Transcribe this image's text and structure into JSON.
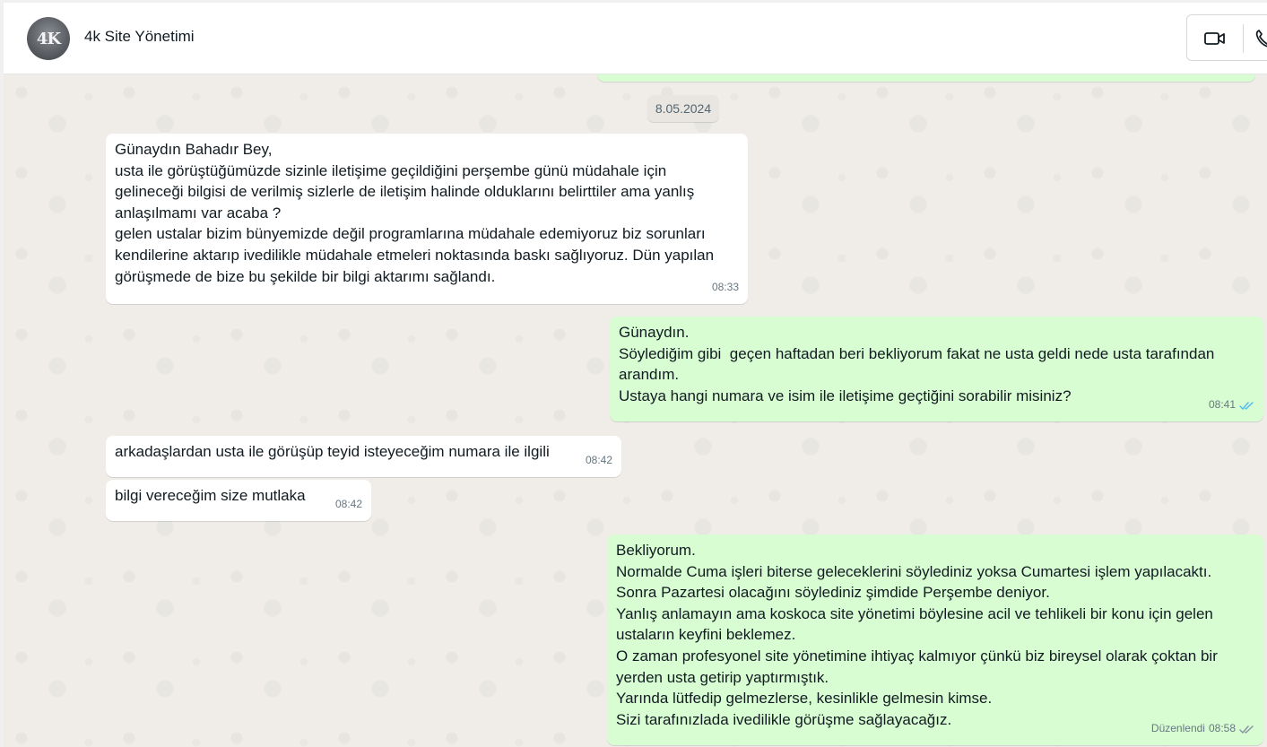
{
  "header": {
    "avatar_text": "4K",
    "title": "4k Site Yönetimi",
    "video_icon": "video-camera-icon",
    "call_icon": "phone-icon"
  },
  "chat": {
    "date_separator": "8.05.2024",
    "messages": [
      {
        "direction": "incoming",
        "lines": [
          "Günaydın Bahadır Bey,",
          "usta ile görüştüğümüzde sizinle iletişime geçildiğini perşembe günü müdahale için",
          "gelineceği bilgisi de verilmiş sizlerle de iletişim halinde olduklarını belirttiler ama yanlış",
          "anlaşılmamı var acaba ?",
          "gelen ustalar bizim bünyemizde değil programlarına müdahale edemiyoruz biz sorunları",
          "kendilerine aktarıp ivedilikle müdahale etmeleri noktasında baskı sağlıyoruz. Dün yapılan",
          "görüşmede de bize bu şekilde bir bilgi aktarımı sağlandı."
        ],
        "time": "08:33"
      },
      {
        "direction": "outgoing",
        "lines": [
          "Günaydın.",
          "Söylediğim gibi  geçen haftadan beri bekliyorum fakat ne usta geldi nede usta tarafından",
          "arandım.",
          "Ustaya hangi numara ve isim ile iletişime geçtiğini sorabilir misiniz?"
        ],
        "time": "08:41",
        "status": "read"
      },
      {
        "direction": "incoming",
        "lines": [
          "arkadaşlardan usta ile görüşüp teyid isteyeceğim numara ile ilgili"
        ],
        "time": "08:42"
      },
      {
        "direction": "incoming",
        "lines": [
          "bilgi vereceğim size mutlaka"
        ],
        "time": "08:42"
      },
      {
        "direction": "outgoing",
        "lines": [
          "Bekliyorum.",
          "Normalde Cuma işleri biterse geleceklerini söylediniz yoksa Cumartesi işlem yapılacaktı.",
          "Sonra Pazartesi olacağını söylediniz şimdide Perşembe deniyor.",
          "Yanlış anlamayın ama koskoca site yönetimi böylesine acil ve tehlikeli bir konu için gelen",
          "ustaların keyfini beklemez.",
          "O zaman profesyonel site yönetimine ihtiyaç kalmıyor çünkü biz bireysel olarak çoktan bir",
          "yerden usta getirip yaptırmıştık.",
          "Yarında lütfedip gelmezlerse, kesinlikle gelmesin kimse.",
          "Sizi tarafınızlada ivedilikle görüşme sağlayacağız."
        ],
        "edited_label": "Düzenlendi",
        "time": "08:58",
        "status": "delivered"
      }
    ]
  },
  "colors": {
    "incoming_bubble": "#ffffff",
    "outgoing_bubble": "#d9fdd3",
    "read_tick": "#53bdeb",
    "delivered_tick": "#8696a0",
    "chat_background": "#f0ede8"
  }
}
